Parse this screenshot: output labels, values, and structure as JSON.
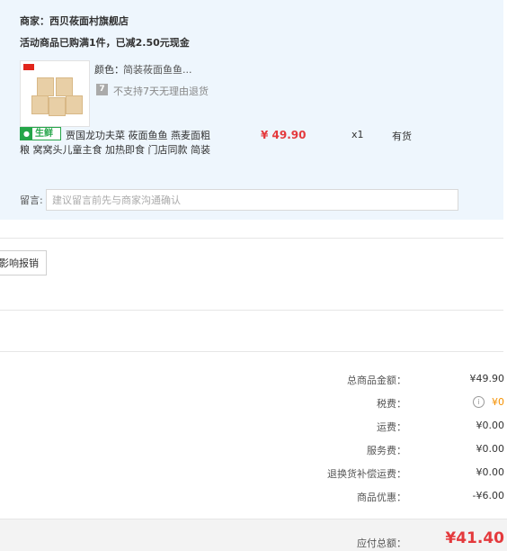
{
  "order": {
    "merchant": "商家：西贝莜面村旗舰店",
    "promo": "活动商品已购满1件，已减2.50元现金",
    "item": {
      "color_label": "颜色：",
      "color_value": "简装莜面鱼鱼...",
      "no_return_icon": "7",
      "no_return": "不支持7天无理由退货",
      "fresh_badge": "生鲜",
      "name_line1": "贾国龙功夫菜 莜面鱼鱼 燕麦面粗",
      "name_line2": "粮 窝窝头儿童主食 加热即食 门店同款 简装",
      "price": "¥ 49.90",
      "qty": "x1",
      "stock": "有货"
    },
    "message": {
      "label": "留言:",
      "placeholder": "建议留言前先与商家沟通确认"
    }
  },
  "invoice": {
    "button_label": "影响报销"
  },
  "summary": {
    "rows": [
      {
        "label": "总商品金额：",
        "value": "¥49.90"
      },
      {
        "label": "税费：",
        "value": "¥0"
      },
      {
        "label": "运费：",
        "value": "¥0.00"
      },
      {
        "label": "服务费：",
        "value": "¥0.00"
      },
      {
        "label": "退换货补偿运费：",
        "value": "¥0.00"
      },
      {
        "label": "商品优惠：",
        "value": "-¥6.00"
      }
    ],
    "total_label": "应付总额：",
    "total_value": "¥41.40"
  },
  "colors": {
    "accent_red": "#e4393c",
    "fresh_green": "#25a549",
    "tax_orange": "#f59100",
    "block_bg": "#eef6fd"
  },
  "icons": [
    "product-thumbnail",
    "no-return-icon",
    "fresh-badge-icon",
    "info-icon"
  ]
}
